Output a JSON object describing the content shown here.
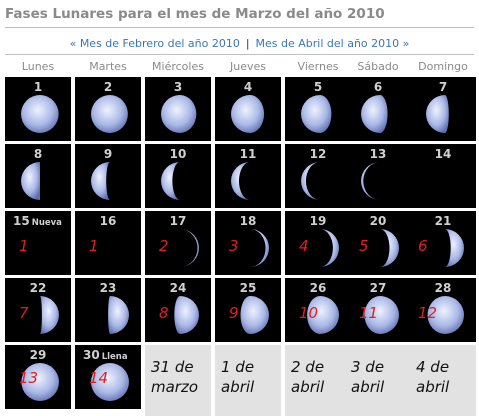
{
  "page": {
    "title": "Fases Lunares para el mes de Marzo del año 2010",
    "prev_link": "« Mes de Febrero del año 2010",
    "separator": "|",
    "next_link": "Mes de Abril del año 2010 »"
  },
  "weekdays": [
    "Lunes",
    "Martes",
    "Miércoles",
    "Jueves",
    "Viernes",
    "Sábado",
    "Domingo"
  ],
  "days": [
    {
      "n": "1",
      "illum": 0.99,
      "lit": "left"
    },
    {
      "n": "2",
      "illum": 0.97,
      "lit": "left"
    },
    {
      "n": "3",
      "illum": 0.93,
      "lit": "left"
    },
    {
      "n": "4",
      "illum": 0.87,
      "lit": "left"
    },
    {
      "n": "5",
      "illum": 0.8,
      "lit": "left"
    },
    {
      "n": "6",
      "illum": 0.7,
      "lit": "left"
    },
    {
      "n": "7",
      "illum": 0.6,
      "lit": "left"
    },
    {
      "n": "8",
      "illum": 0.5,
      "lit": "left"
    },
    {
      "n": "9",
      "illum": 0.4,
      "lit": "left"
    },
    {
      "n": "10",
      "illum": 0.3,
      "lit": "left"
    },
    {
      "n": "11",
      "illum": 0.21,
      "lit": "left"
    },
    {
      "n": "12",
      "illum": 0.13,
      "lit": "left"
    },
    {
      "n": "13",
      "illum": 0.06,
      "lit": "left"
    },
    {
      "n": "14",
      "illum": 0.0,
      "lit": "left"
    },
    {
      "n": "15",
      "illum": 0.0,
      "lit": "right",
      "tag": "Nueva",
      "mark": "1"
    },
    {
      "n": "16",
      "illum": 0.0,
      "lit": "right",
      "mark": "1"
    },
    {
      "n": "17",
      "illum": 0.04,
      "lit": "right",
      "mark": "2"
    },
    {
      "n": "18",
      "illum": 0.09,
      "lit": "right",
      "mark": "3"
    },
    {
      "n": "19",
      "illum": 0.16,
      "lit": "right",
      "mark": "4"
    },
    {
      "n": "20",
      "illum": 0.25,
      "lit": "right",
      "mark": "5"
    },
    {
      "n": "21",
      "illum": 0.35,
      "lit": "right",
      "mark": "6"
    },
    {
      "n": "22",
      "illum": 0.45,
      "lit": "right",
      "mark": "7"
    },
    {
      "n": "23",
      "illum": 0.55,
      "lit": "right",
      "mark": ""
    },
    {
      "n": "24",
      "illum": 0.65,
      "lit": "right",
      "mark": "8"
    },
    {
      "n": "25",
      "illum": 0.75,
      "lit": "right",
      "mark": "9"
    },
    {
      "n": "26",
      "illum": 0.84,
      "lit": "right",
      "mark": "10"
    },
    {
      "n": "27",
      "illum": 0.91,
      "lit": "right",
      "mark": "11"
    },
    {
      "n": "28",
      "illum": 0.96,
      "lit": "right",
      "mark": "12"
    },
    {
      "n": "29",
      "illum": 0.99,
      "lit": "right",
      "mark": "13"
    },
    {
      "n": "30",
      "illum": 1.0,
      "lit": "right",
      "tag": "Llena",
      "mark": "14"
    }
  ],
  "extra_cells": [
    {
      "line1": "31 de",
      "line2": "marzo"
    },
    {
      "line1": "1 de",
      "line2": "abril"
    },
    {
      "line1": "2 de",
      "line2": "abril"
    },
    {
      "line1": "3 de",
      "line2": "abril"
    },
    {
      "line1": "4 de",
      "line2": "abril"
    }
  ],
  "colors": {
    "moon_light": "#eef2ff",
    "moon_mid": "#aab8e6",
    "moon_edge": "#5d6fb0",
    "mark": "#e02020"
  }
}
